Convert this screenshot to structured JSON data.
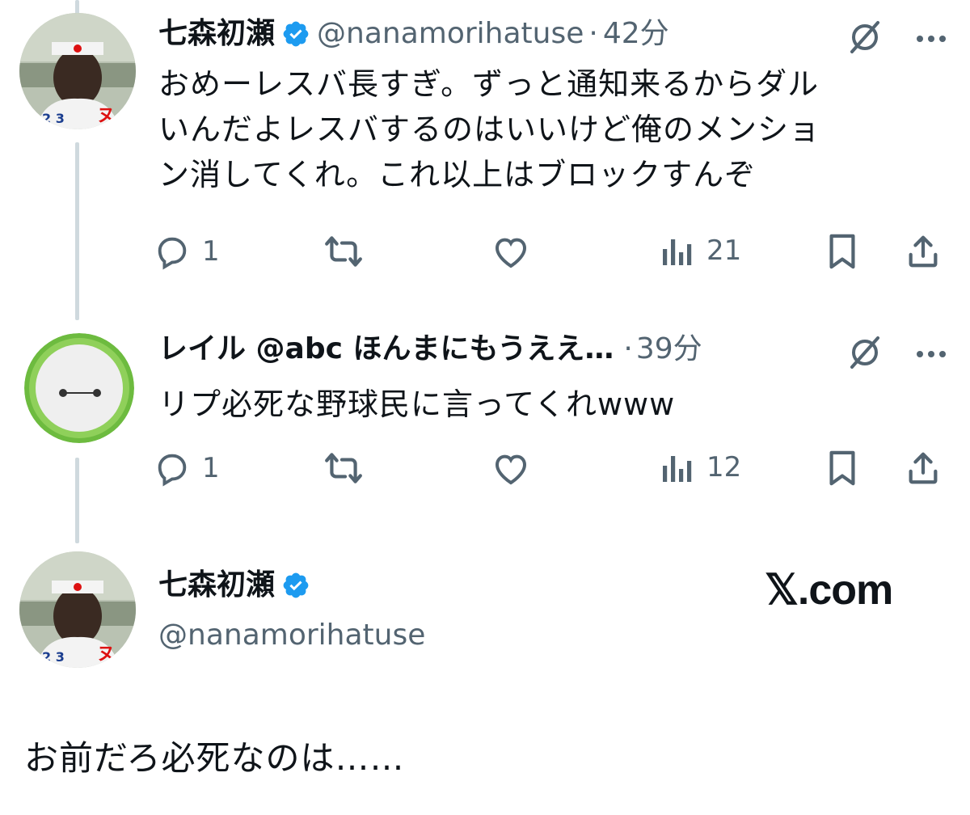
{
  "colors": {
    "verified": "#1d9bf0",
    "muted": "#536471",
    "text": "#0f1419",
    "thread_line": "#cfd9de"
  },
  "post1": {
    "name": "七森初瀬",
    "handle": "@nanamorihatuse",
    "dot": "·",
    "time": "42分",
    "text_line1": "おめーレスバ長すぎ。ずっと通知来るからダル",
    "text_line2": "いんだよレスバするのはいいけど俺のメンショ",
    "text_line3": "ン消してくれ。これ以上はブロックすんぞ",
    "replies": "1",
    "views": "21"
  },
  "post2": {
    "name_handle": "レイル @abc ほんまにもうええ…",
    "dot": "·",
    "time": "39分",
    "text": "リプ必死な野球民に言ってくれwww",
    "replies": "1",
    "views": "12"
  },
  "quote": {
    "name": "七森初瀬",
    "handle": "@nanamorihatuse",
    "brand": "𝕏.com",
    "text": "お前だろ必死なのは……"
  },
  "icons": [
    "verified-badge-icon",
    "grok-icon",
    "more-icon",
    "reply-icon",
    "repost-icon",
    "like-icon",
    "views-icon",
    "bookmark-icon",
    "share-icon"
  ]
}
